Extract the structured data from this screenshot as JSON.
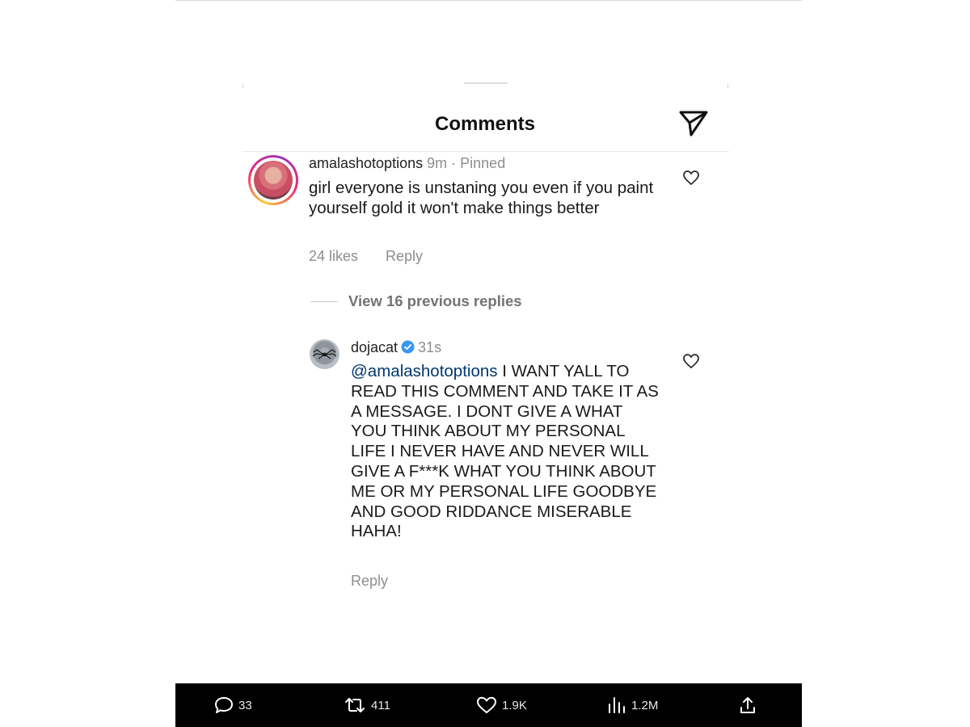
{
  "sheet": {
    "title": "Comments",
    "send_icon": "send-icon"
  },
  "comments": [
    {
      "username": "amalashotoptions",
      "time": "9m",
      "pinned": "Pinned",
      "text": "girl everyone is unstaning you even if you paint yourself gold it won't make things better",
      "likes": "24 likes",
      "reply_label": "Reply",
      "avatar_ring_colors": [
        "#f9ce34",
        "#ee2a7b",
        "#9b36b7"
      ]
    },
    {
      "username": "dojacat",
      "verified": true,
      "time": "31s",
      "mention": "@amalashotoptions",
      "text": " I WANT YALL TO READ THIS COMMENT AND TAKE IT AS A MESSAGE. I DONT GIVE A      WHAT YOU THINK ABOUT MY PERSONAL LIFE I NEVER HAVE AND NEVER WILL GIVE A F***K WHAT YOU THINK ABOUT ME OR MY PERSONAL LIFE GOODBYE AND GOOD RIDDANCE MISERABLE      HAHA!",
      "reply_label": "Reply"
    }
  ],
  "view_replies_label": "View 16 previous replies",
  "action_bar": {
    "replies": "33",
    "reposts": "411",
    "likes": "1.9K",
    "views": "1.2M"
  },
  "colors": {
    "verified_blue": "#3897f0",
    "mention_blue": "#00376b",
    "muted_gray": "#8e8e8e"
  }
}
